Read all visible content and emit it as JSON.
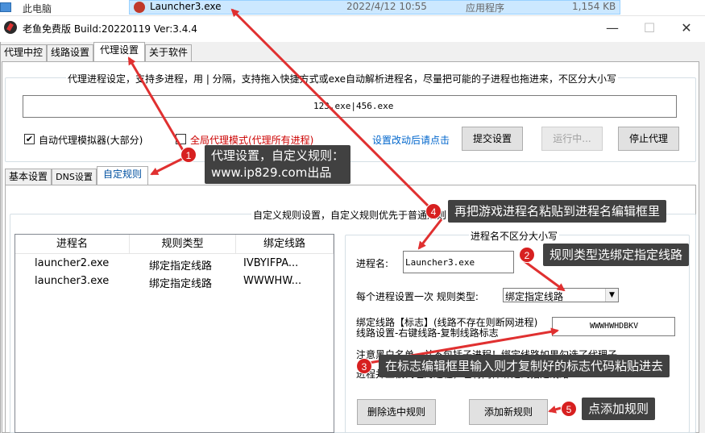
{
  "explorer": {
    "this_pc": "此电脑",
    "file_name": "Launcher3.exe",
    "file_date": "2022/4/12 10:55",
    "file_type": "应用程序",
    "file_size": "1,154 KB"
  },
  "window": {
    "title": "老鱼免费版 Build:20220119 Ver:3.4.4",
    "minimize": "—",
    "maximize": "☐",
    "close": "✕"
  },
  "top_tabs": [
    "代理中控",
    "线路设置",
    "代理设置",
    "关于软件"
  ],
  "proxy_settings": {
    "process_group_legend": "代理进程设定，支持多进程，用 | 分隔，支持拖入快捷方式或exe自动解析进程名，尽量把可能的子进程也拖进来，不区分大小写",
    "process_input_value": "123.exe|456.exe",
    "auto_proxy_emulator_label": "自动代理模拟器(大部分)",
    "auto_proxy_emulator_checked": true,
    "global_proxy_label": "全局代理模式(代理所有进程)",
    "global_proxy_checked": false,
    "hint_link": "设置改动后请点击",
    "submit_button": "提交设置",
    "running_button": "运行中...",
    "stop_button": "停止代理"
  },
  "sub_tabs": [
    "基本设置",
    "DNS设置",
    "自定规则"
  ],
  "custom_rules": {
    "group_legend": "自定义规则设置，自定义规则优先于普通规则",
    "columns": [
      "进程名",
      "规则类型",
      "绑定线路"
    ],
    "rows": [
      [
        "launcher2.exe",
        "绑定指定线路",
        "IVBYIFPA..."
      ],
      [
        "launcher3.exe",
        "绑定指定线路",
        "WWWHW..."
      ]
    ],
    "edit_legend": "进程名不区分大小写",
    "process_name_label": "进程名:",
    "process_name_value": "Launcher3.exe",
    "rule_type_label": "每个进程设置一次 规则类型:",
    "rule_type_value": "绑定指定线路",
    "bind_line_label_1": "绑定线路【标志】(线路不存在则断网进程)",
    "bind_line_label_2": "线路设置-右键线路-复制线路标志",
    "bind_line_value": "WWWHWHDBKV",
    "note_1": "注意黑白名单，并不包括子进程！绑定线路如果勾选了代理子",
    "note_2": "进程并且被代理的进程，也将同样绑定到指定线路",
    "delete_button": "删除选中规则",
    "add_button": "添加新规则"
  },
  "annotations": {
    "step1_badge": "1",
    "step1_text_1": "代理设置，自定义规则：",
    "step1_text_2": "www.ip829.com出品",
    "step2_badge": "2",
    "step2_text": "规则类型选绑定指定线路",
    "step3_badge": "3",
    "step3_text": "在标志编辑框里输入则才复制好的标志代码粘贴进去",
    "step4_badge": "4",
    "step4_text": "再把游戏进程名粘贴到进程名编辑框里",
    "step5_badge": "5",
    "step5_text": "点添加规则",
    "arrow_color": "#e03030"
  }
}
